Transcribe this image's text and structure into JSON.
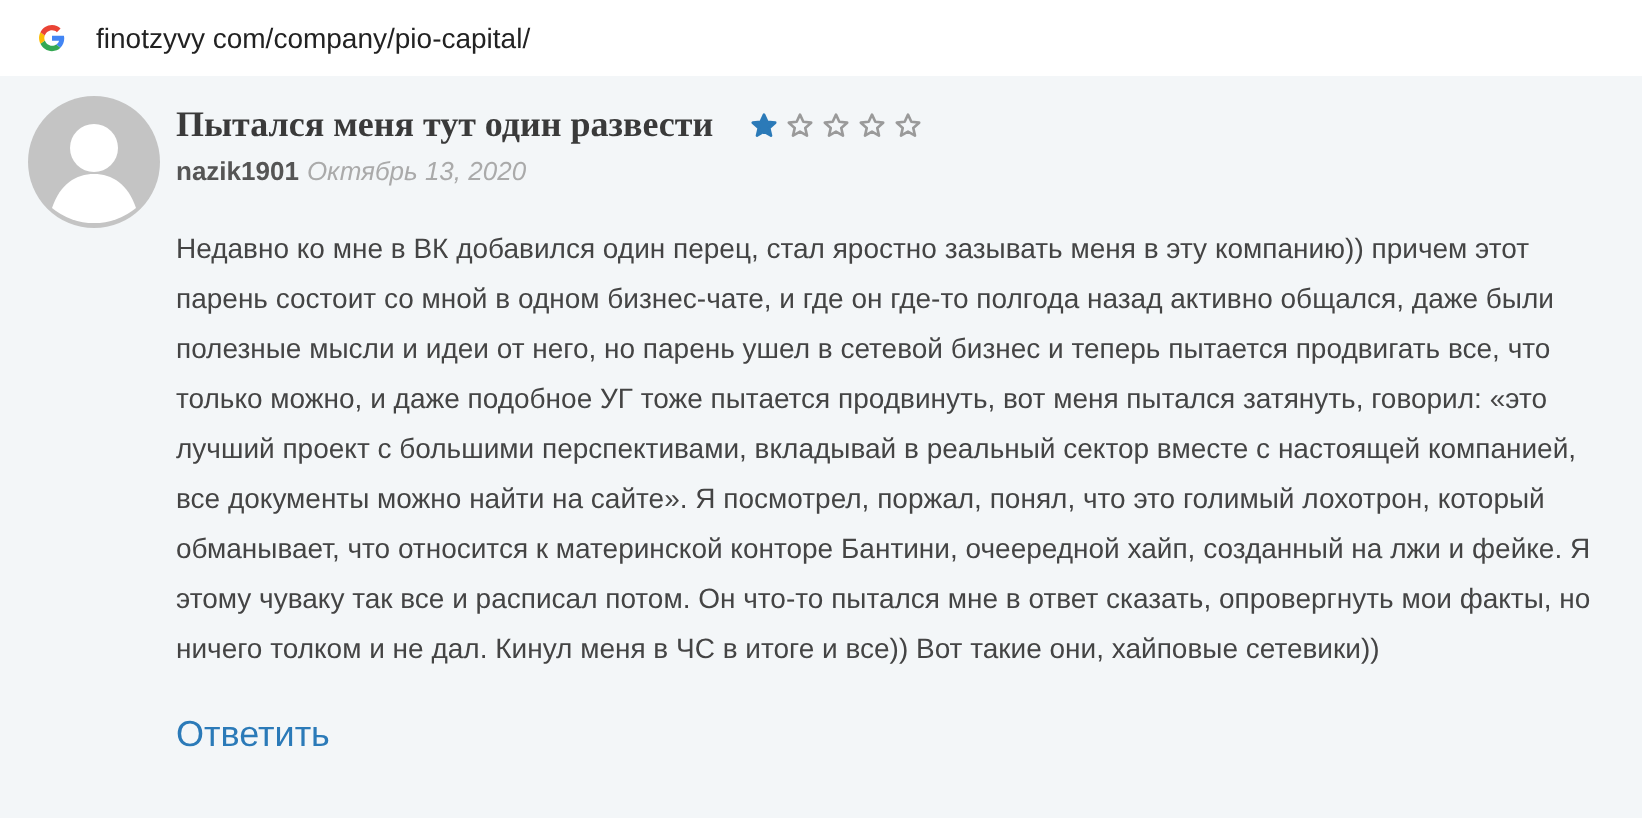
{
  "address_bar": {
    "url": "finotzyvy com/company/pio-capital/"
  },
  "review": {
    "title": "Пытался меня тут один развести",
    "stars": 1,
    "author": "nazik1901",
    "date": "Октябрь 13, 2020",
    "text": "Недавно ко мне в ВК добавился один перец, стал яростно зазывать меня в эту компанию)) причем этот парень состоит со мной в одном бизнес-чате, и где он где-то полгода назад активно общался, даже были полезные мысли и идеи от него, но парень ушел в сетевой бизнес и теперь пытается продвигать все, что только можно, и даже подобное УГ тоже пытается продвинуть, вот меня пытался затянуть, говорил: «это лучший проект с большими перспективами, вкладывай в реальный сектор вместе с настоящей компанией, все документы можно найти на сайте». Я посмотрел, поржал, понял, что это голимый лохотрон, который обманывает, что относится к материнской конторе Бантини, очеередной хайп, созданный на лжи и фейке. Я этому чуваку так все и расписал потом. Он что-то пытался мне в ответ сказать, опровергнуть мои факты, но ничего толком и не дал. Кинул меня в ЧС в итоге и все)) Вот такие они, хайповые сетевики))",
    "reply_link": "Ответить"
  }
}
